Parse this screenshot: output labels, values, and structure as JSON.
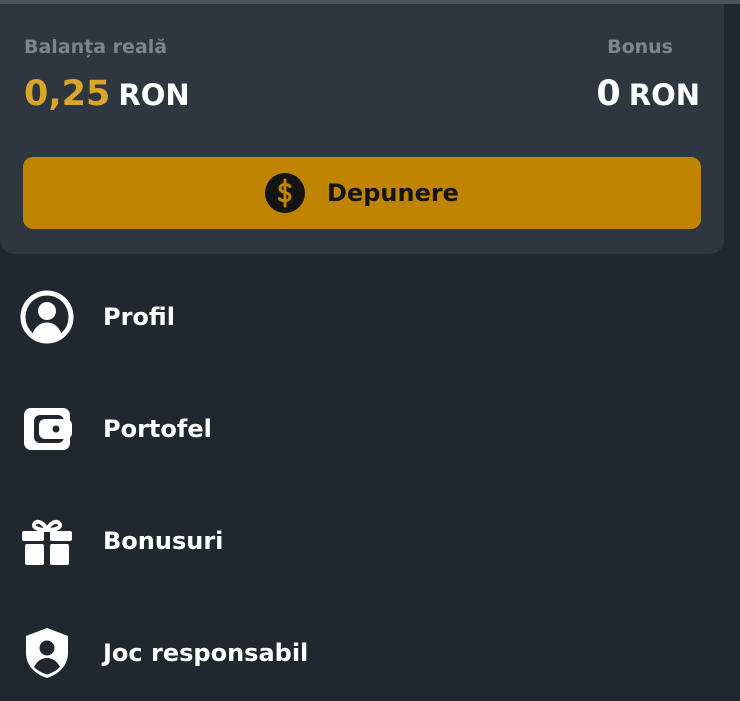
{
  "balance": {
    "real_label": "Balanța reală",
    "real_amount": "0,25",
    "real_currency": "RON",
    "bonus_label": "Bonus",
    "bonus_amount": "0",
    "bonus_currency": "RON"
  },
  "deposit": {
    "label": "Depunere",
    "icon": "dollar-coin-icon"
  },
  "menu": [
    {
      "label": "Profil",
      "icon": "user-circle-icon"
    },
    {
      "label": "Portofel",
      "icon": "wallet-icon"
    },
    {
      "label": "Bonusuri",
      "icon": "gift-icon"
    },
    {
      "label": "Joc responsabil",
      "icon": "shield-user-icon"
    }
  ],
  "colors": {
    "background": "#21272e",
    "card": "#2e3640",
    "accent_gold": "#bf8500",
    "amount_gold": "#d9a52a",
    "muted_label": "#7c8590",
    "text": "#ffffff"
  }
}
